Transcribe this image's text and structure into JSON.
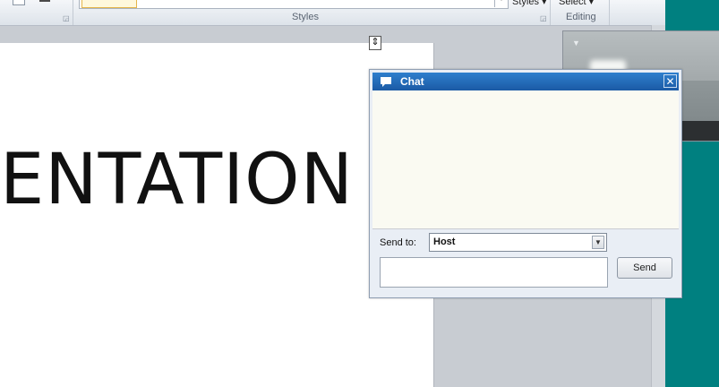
{
  "ribbon": {
    "styles_group_label": "Styles",
    "editing_group_label": "Editing",
    "change_styles_label": "Styles ▾",
    "select_label": "Select ▾"
  },
  "document": {
    "heading_text": "ENTATION"
  },
  "chat": {
    "title": "Chat",
    "close_glyph": "✕",
    "send_to_label": "Send to:",
    "recipient_value": "Host",
    "message_value": "",
    "send_button_label": "Send"
  },
  "icons": {
    "chat": "chat-bubble-icon",
    "close": "close-icon",
    "dropdown": "chevron-down-icon"
  },
  "colors": {
    "title_bar": "#1b5aa5",
    "teal_background": "#008080"
  }
}
